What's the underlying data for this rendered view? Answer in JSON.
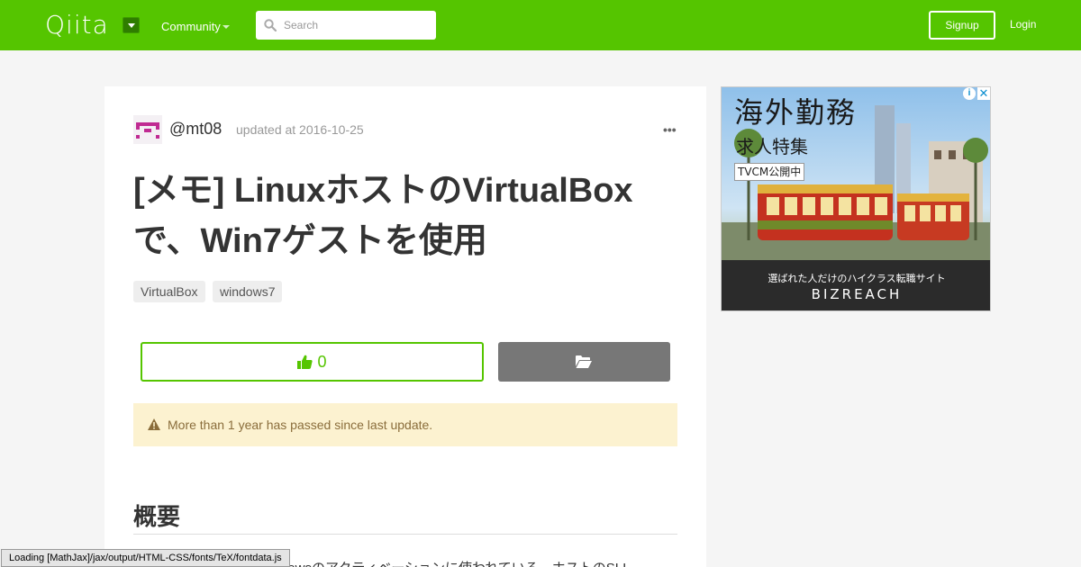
{
  "header": {
    "logo": "Qiita",
    "community_label": "Community",
    "search_placeholder": "Search",
    "signup_label": "Signup",
    "login_label": "Login"
  },
  "article": {
    "username": "@mt08",
    "updated": "updated at 2016-10-25",
    "more": "•••",
    "title": "[メモ] LinuxホストのVirtualBoxで、Win7ゲストを使用",
    "tags": [
      "VirtualBox",
      "windows7"
    ],
    "like_count": "0",
    "alert": "More than 1 year has passed since last update.",
    "heading": "概要",
    "body_snippet": "VirtualBoxでは、Windowsのアクティベーションに使われている、ホストのSLI"
  },
  "ad": {
    "headline": "海外勤務",
    "sub": "求人特集",
    "badge": "TVCM公開中",
    "tagline": "選ばれた人だけのハイクラス転職サイト",
    "brand": "BIZREACH",
    "info": "i",
    "close": "✕"
  },
  "status_bar": "Loading [MathJax]/jax/output/HTML-CSS/fonts/TeX/fontdata.js",
  "colors": {
    "brand_green": "#55c500",
    "alert_bg": "#fcf2d0",
    "alert_text": "#8a6d3b"
  }
}
